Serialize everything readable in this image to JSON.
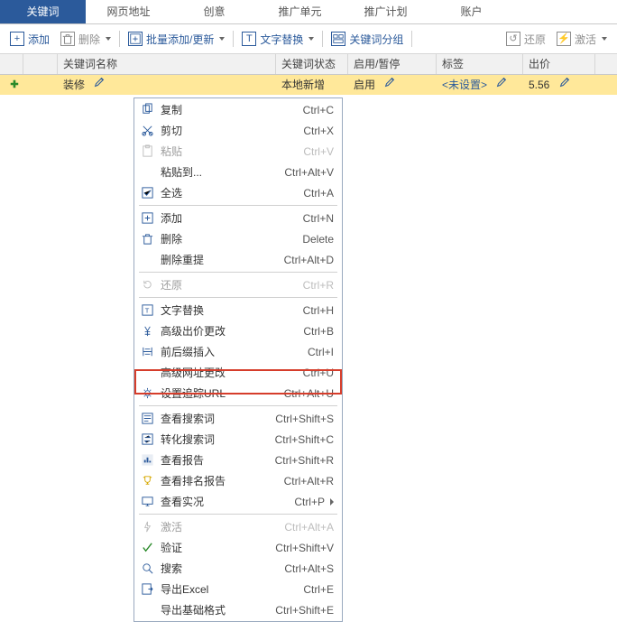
{
  "tabs": {
    "keyword": "关键词",
    "url": "网页地址",
    "creative": "创意",
    "unit": "推广单元",
    "plan": "推广计划",
    "account": "账户"
  },
  "toolbar": {
    "add": "添加",
    "delete": "删除",
    "bulk": "批量添加/更新",
    "textReplace": "文字替换",
    "group": "关键词分组",
    "restore": "还原",
    "activate": "激活"
  },
  "columns": {
    "name": "关键词名称",
    "status": "关键词状态",
    "enable": "启用/暂停",
    "tag": "标签",
    "price": "出价"
  },
  "row": {
    "name": "装修",
    "status": "本地新增",
    "enable": "启用",
    "tag": "<未设置>",
    "price": "5.56"
  },
  "menu": {
    "copy": {
      "label": "复制",
      "shortcut": "Ctrl+C"
    },
    "cut": {
      "label": "剪切",
      "shortcut": "Ctrl+X"
    },
    "paste": {
      "label": "粘贴",
      "shortcut": "Ctrl+V"
    },
    "pasteTo": {
      "label": "粘贴到...",
      "shortcut": "Ctrl+Alt+V"
    },
    "selAll": {
      "label": "全选",
      "shortcut": "Ctrl+A"
    },
    "add": {
      "label": "添加",
      "shortcut": "Ctrl+N"
    },
    "del": {
      "label": "删除",
      "shortcut": "Delete"
    },
    "delDup": {
      "label": "删除重提",
      "shortcut": "Ctrl+Alt+D"
    },
    "restore": {
      "label": "还原",
      "shortcut": "Ctrl+R"
    },
    "textRep": {
      "label": "文字替换",
      "shortcut": "Ctrl+H"
    },
    "advBid": {
      "label": "高级出价更改",
      "shortcut": "Ctrl+B"
    },
    "prefix": {
      "label": "前后缀插入",
      "shortcut": "Ctrl+I"
    },
    "advUrl": {
      "label": "高级网址更改",
      "shortcut": "Ctrl+U"
    },
    "trackUrl": {
      "label": "设置追踪URL",
      "shortcut": "Ctrl+Alt+U"
    },
    "seeSearch": {
      "label": "查看搜索词",
      "shortcut": "Ctrl+Shift+S"
    },
    "convSearch": {
      "label": "转化搜索词",
      "shortcut": "Ctrl+Shift+C"
    },
    "seeReport": {
      "label": "查看报告",
      "shortcut": "Ctrl+Shift+R"
    },
    "rankReport": {
      "label": "查看排名报告",
      "shortcut": "Ctrl+Alt+R"
    },
    "liveView": {
      "label": "查看实况",
      "shortcut": "Ctrl+P"
    },
    "activate": {
      "label": "激活",
      "shortcut": "Ctrl+Alt+A"
    },
    "verify": {
      "label": "验证",
      "shortcut": "Ctrl+Shift+V"
    },
    "search": {
      "label": "搜索",
      "shortcut": "Ctrl+Alt+S"
    },
    "exportX": {
      "label": "导出Excel",
      "shortcut": "Ctrl+E"
    },
    "exportB": {
      "label": "导出基础格式",
      "shortcut": "Ctrl+Shift+E"
    }
  }
}
